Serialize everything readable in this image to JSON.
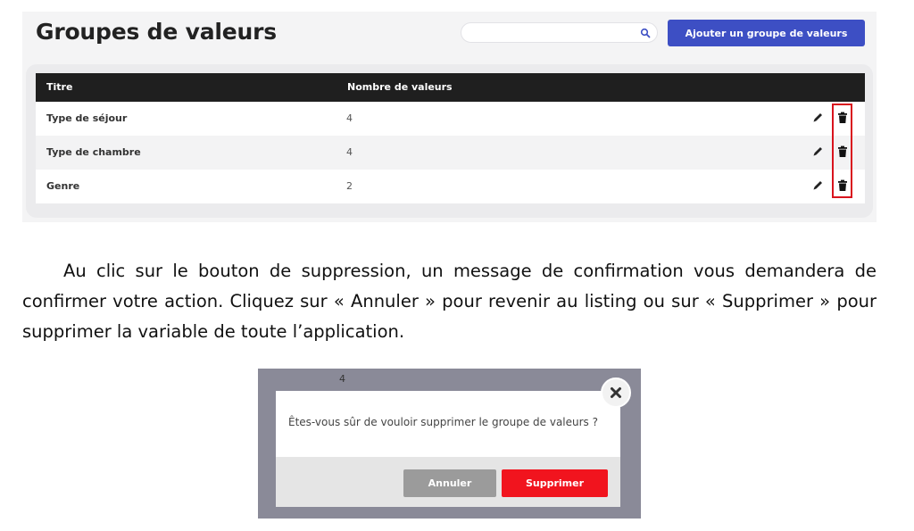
{
  "list_screen": {
    "title": "Groupes de valeurs",
    "search": {
      "value": "",
      "icon": "search-icon"
    },
    "add_button_label": "Ajouter un groupe de valeurs",
    "colors": {
      "accent": "#3d4fc4",
      "header": "#1f1f1f",
      "highlight": "#d9141e"
    },
    "table": {
      "columns": [
        "Titre",
        "Nombre de valeurs"
      ],
      "rows": [
        {
          "title": "Type de séjour",
          "count": "4"
        },
        {
          "title": "Type de chambre",
          "count": "4"
        },
        {
          "title": "Genre",
          "count": "2"
        }
      ],
      "row_actions": [
        "pencil-icon",
        "trash-icon"
      ]
    }
  },
  "paragraph": {
    "text": "Au clic sur le bouton de suppression, un message de confirmation vous demandera de confirmer votre action. Cliquez sur « Annuler » pour revenir au listing ou sur « Supprimer » pour supprimer la variable de toute l’application."
  },
  "dialog_screen": {
    "background_value": "4",
    "message": "Êtes-vous sûr de vouloir supprimer le groupe de valeurs ?",
    "cancel_label": "Annuler",
    "delete_label": "Supprimer",
    "close_icon": "close-icon",
    "colors": {
      "cancel": "#9b9b9b",
      "delete": "#f1141e",
      "overlay": "#8a8a98"
    }
  }
}
